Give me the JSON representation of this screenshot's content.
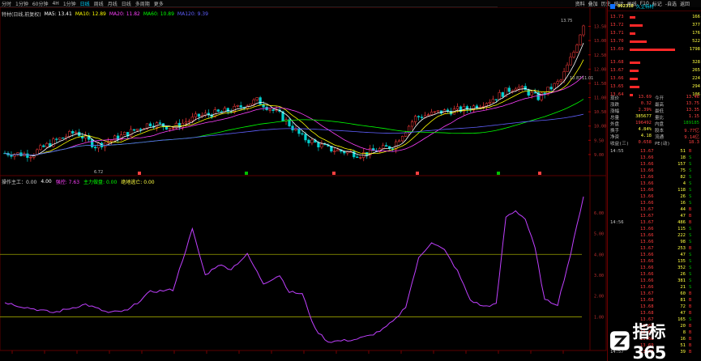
{
  "toolbar": {
    "tabs": [
      "分时",
      "1分钟",
      "60分钟",
      "4H",
      "1分钟",
      "日线",
      "周线",
      "月线",
      "日线",
      "多周期",
      "更多"
    ],
    "active_index": 5
  },
  "right_toolbar": [
    "资料",
    "叠加",
    "历史",
    "统计",
    "画线",
    "F10",
    "标记",
    "-自选",
    "返回"
  ],
  "indicators": {
    "title": "特材(日线,前复权)",
    "ma5": "MA5: 13.41",
    "ma10": "MA10: 12.89",
    "ma20": "MA20: 11.82",
    "ma60": "MA60: 10.89",
    "ma120": "MA120: 9.39",
    "ma_colors": [
      "#ffffff",
      "#ffff00",
      "#ff40ff",
      "#00ff00",
      "#6060ff"
    ]
  },
  "sub_indicators": {
    "name": "操作主工：0.00",
    "v1": "4.00",
    "v2": "强控: 7.63",
    "v3": "主力做盘: 0.00",
    "v4": "绝地逃亡: 0.00"
  },
  "chart_text": {
    "high_label": "13.75",
    "low_label": "6.72",
    "mid_label": "10.87",
    "sub_low_label": "11.01"
  },
  "price_axis": [
    "13.50",
    "13.00",
    "12.50",
    "12.00",
    "11.50",
    "11.00",
    "10.50",
    "10.00",
    "9.50",
    "9.00"
  ],
  "sub_axis": [
    "6.00",
    "5.00",
    "4.00",
    "3.00",
    "2.00",
    "1.00"
  ],
  "stock": {
    "code": "002318",
    "name": "久立特材"
  },
  "orderbook": [
    {
      "price": "13.73",
      "vol": "166",
      "bar": 0.12
    },
    {
      "price": "13.72",
      "vol": "377",
      "bar": 0.28
    },
    {
      "price": "13.71",
      "vol": "176",
      "bar": 0.13
    },
    {
      "price": "13.70",
      "vol": "522",
      "bar": 0.38
    },
    {
      "price": "13.69",
      "vol": "1798",
      "bar": 1.0
    },
    {
      "price": "13.68",
      "vol": "328",
      "bar": 0.24
    },
    {
      "price": "13.67",
      "vol": "265",
      "bar": 0.19
    },
    {
      "price": "13.66",
      "vol": "224",
      "bar": 0.17
    },
    {
      "price": "13.65",
      "vol": "294",
      "bar": 0.21
    },
    {
      "price": "13.64",
      "vol": "106",
      "bar": 0.08
    }
  ],
  "stats": [
    {
      "l1": "现价",
      "v1": "13.69",
      "l2": "今开",
      "v2": "13.46"
    },
    {
      "l1": "涨跌",
      "v1": "0.32",
      "l2": "最高",
      "v2": "13.75"
    },
    {
      "l1": "涨幅",
      "v1": "2.39%",
      "l2": "最低",
      "v2": "13.35"
    },
    {
      "l1": "总量",
      "v1": "385677",
      "l2": "量比",
      "v2": "1.15"
    },
    {
      "l1": "外盘",
      "v1": "196492",
      "l2": "内盘",
      "v2": "189185"
    },
    {
      "l1": "换手",
      "v1": "4.84%",
      "l2": "股本",
      "v2": "9.77亿"
    },
    {
      "l1": "净资",
      "v1": "4.18",
      "l2": "流通",
      "v2": "9.14亿"
    },
    {
      "l1": "收益(三)",
      "v1": "0.658",
      "l2": "PE(动)",
      "v2": "18.3"
    }
  ],
  "trades": [
    {
      "time": "14:55",
      "price": "13.67",
      "vol": "51",
      "side": "B"
    },
    {
      "time": "",
      "price": "13.66",
      "vol": "18",
      "side": "S"
    },
    {
      "time": "",
      "price": "13.66",
      "vol": "157",
      "side": "S"
    },
    {
      "time": "",
      "price": "13.66",
      "vol": "75",
      "side": "S"
    },
    {
      "time": "",
      "price": "13.66",
      "vol": "82",
      "side": "S"
    },
    {
      "time": "",
      "price": "13.66",
      "vol": "4",
      "side": "S"
    },
    {
      "time": "",
      "price": "13.66",
      "vol": "118",
      "side": "S"
    },
    {
      "time": "",
      "price": "13.66",
      "vol": "26",
      "side": "S"
    },
    {
      "time": "",
      "price": "13.66",
      "vol": "16",
      "side": "S"
    },
    {
      "time": "",
      "price": "13.67",
      "vol": "44",
      "side": "B"
    },
    {
      "time": "",
      "price": "13.67",
      "vol": "47",
      "side": "B"
    },
    {
      "time": "14:56",
      "price": "13.67",
      "vol": "486",
      "side": "B"
    },
    {
      "time": "",
      "price": "13.66",
      "vol": "115",
      "side": "S"
    },
    {
      "time": "",
      "price": "13.66",
      "vol": "222",
      "side": "S"
    },
    {
      "time": "",
      "price": "13.66",
      "vol": "98",
      "side": "S"
    },
    {
      "time": "",
      "price": "13.67",
      "vol": "253",
      "side": "B"
    },
    {
      "time": "",
      "price": "13.66",
      "vol": "47",
      "side": "S"
    },
    {
      "time": "",
      "price": "13.66",
      "vol": "135",
      "side": "S"
    },
    {
      "time": "",
      "price": "13.66",
      "vol": "352",
      "side": "S"
    },
    {
      "time": "",
      "price": "13.66",
      "vol": "26",
      "side": "S"
    },
    {
      "time": "",
      "price": "13.66",
      "vol": "381",
      "side": "S"
    },
    {
      "time": "",
      "price": "13.66",
      "vol": "21",
      "side": "S"
    },
    {
      "time": "",
      "price": "13.67",
      "vol": "60",
      "side": "B"
    },
    {
      "time": "",
      "price": "13.68",
      "vol": "81",
      "side": "B"
    },
    {
      "time": "",
      "price": "13.68",
      "vol": "72",
      "side": "B"
    },
    {
      "time": "",
      "price": "13.68",
      "vol": "47",
      "side": "B"
    },
    {
      "time": "",
      "price": "13.67",
      "vol": "165",
      "side": "S"
    },
    {
      "time": "",
      "price": "13.68",
      "vol": "20",
      "side": "B"
    },
    {
      "time": "",
      "price": "13.68",
      "vol": "8",
      "side": "B"
    },
    {
      "time": "",
      "price": "13.68",
      "vol": "16",
      "side": "B"
    },
    {
      "time": "",
      "price": "13.69",
      "vol": "51",
      "side": "B"
    },
    {
      "time": "14:57",
      "price": "13.69",
      "vol": "39",
      "side": "B"
    }
  ],
  "watermark": {
    "text": "指标365"
  }
}
